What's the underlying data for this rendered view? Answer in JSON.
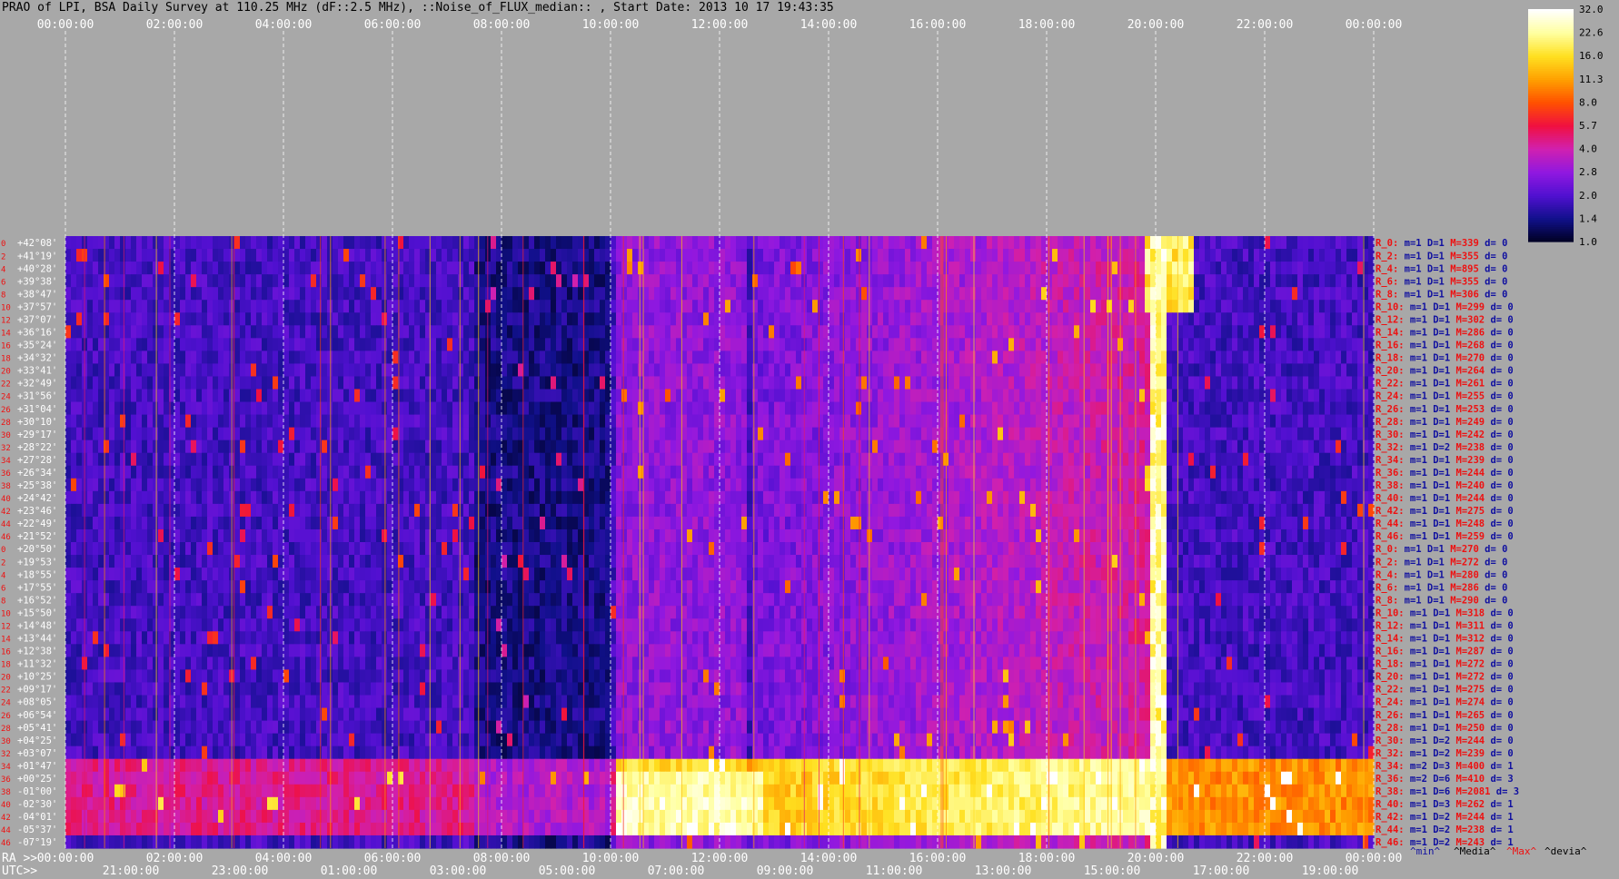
{
  "title": "PRAO of LPI, BSA Daily Survey at 110.25 MHz (dF::2.5 MHz), ::Noise_of_FLUX_median:: , Start Date: 2013 10 17 19:43:35",
  "chart_data": {
    "type": "heatmap",
    "top_axis_ticks": [
      "00:00:00",
      "02:00:00",
      "04:00:00",
      "06:00:00",
      "08:00:00",
      "10:00:00",
      "12:00:00",
      "14:00:00",
      "16:00:00",
      "18:00:00",
      "20:00:00",
      "22:00:00",
      "00:00:00"
    ],
    "ra_prefix": "RA >>",
    "ra_ticks": [
      "00:00:00",
      "02:00:00",
      "04:00:00",
      "06:00:00",
      "08:00:00",
      "10:00:00",
      "12:00:00",
      "14:00:00",
      "16:00:00",
      "18:00:00",
      "20:00:00",
      "22:00:00",
      "00:00:00"
    ],
    "utc_prefix": "UTC>>",
    "utc_ticks": [
      "21:00:00",
      "23:00:00",
      "01:00:00",
      "03:00:00",
      "05:00:00",
      "07:00:00",
      "09:00:00",
      "11:00:00",
      "13:00:00",
      "15:00:00",
      "17:00:00",
      "19:00:00"
    ],
    "declinations": [
      "+42°08'",
      "+41°19'",
      "+40°28'",
      "+39°38'",
      "+38°47'",
      "+37°57'",
      "+37°07'",
      "+36°16'",
      "+35°24'",
      "+34°32'",
      "+33°41'",
      "+32°49'",
      "+31°56'",
      "+31°04'",
      "+30°10'",
      "+29°17'",
      "+28°22'",
      "+27°28'",
      "+26°34'",
      "+25°38'",
      "+24°42'",
      "+23°46'",
      "+22°49'",
      "+21°52'",
      "+20°50'",
      "+19°53'",
      "+18°55'",
      "+17°55'",
      "+16°52'",
      "+15°50'",
      "+14°48'",
      "+13°44'",
      "+12°38'",
      "+11°32'",
      "+10°25'",
      "+09°17'",
      "+08°05'",
      "+06°54'",
      "+05°41'",
      "+04°25'",
      "+03°07'",
      "+01°47'",
      "+00°25'",
      "-01°00'",
      "-02°30'",
      "-04°01'",
      "-05°37'",
      "-07°19'"
    ],
    "row_index_labels": [
      "0",
      "2",
      "4",
      "6",
      "8",
      "10",
      "12",
      "14",
      "16",
      "18",
      "20",
      "22",
      "24",
      "26",
      "28",
      "30",
      "32",
      "34",
      "36",
      "38",
      "40",
      "42",
      "44",
      "46",
      "0",
      "2",
      "4",
      "6",
      "8",
      "10",
      "12",
      "14",
      "16",
      "18",
      "20",
      "22",
      "24",
      "26",
      "28",
      "30",
      "32",
      "34",
      "36",
      "38",
      "40",
      "42",
      "44",
      "46"
    ],
    "beam_stats": [
      {
        "r": "R_0:",
        "m": "m=1",
        "D": "D=1",
        "M": "M=339",
        "d": "d= 0"
      },
      {
        "r": "R_2:",
        "m": "m=1",
        "D": "D=1",
        "M": "M=355",
        "d": "d= 0"
      },
      {
        "r": "R_4:",
        "m": "m=1",
        "D": "D=1",
        "M": "M=895",
        "d": "d= 0"
      },
      {
        "r": "R_6:",
        "m": "m=1",
        "D": "D=1",
        "M": "M=355",
        "d": "d= 0"
      },
      {
        "r": "R_8:",
        "m": "m=1",
        "D": "D=1",
        "M": "M=306",
        "d": "d= 0"
      },
      {
        "r": "R_10:",
        "m": "m=1",
        "D": "D=1",
        "M": "M=299",
        "d": "d= 0"
      },
      {
        "r": "R_12:",
        "m": "m=1",
        "D": "D=1",
        "M": "M=302",
        "d": "d= 0"
      },
      {
        "r": "R_14:",
        "m": "m=1",
        "D": "D=1",
        "M": "M=286",
        "d": "d= 0"
      },
      {
        "r": "R_16:",
        "m": "m=1",
        "D": "D=1",
        "M": "M=268",
        "d": "d= 0"
      },
      {
        "r": "R_18:",
        "m": "m=1",
        "D": "D=1",
        "M": "M=270",
        "d": "d= 0"
      },
      {
        "r": "R_20:",
        "m": "m=1",
        "D": "D=1",
        "M": "M=264",
        "d": "d= 0"
      },
      {
        "r": "R_22:",
        "m": "m=1",
        "D": "D=1",
        "M": "M=261",
        "d": "d= 0"
      },
      {
        "r": "R_24:",
        "m": "m=1",
        "D": "D=1",
        "M": "M=255",
        "d": "d= 0"
      },
      {
        "r": "R_26:",
        "m": "m=1",
        "D": "D=1",
        "M": "M=253",
        "d": "d= 0"
      },
      {
        "r": "R_28:",
        "m": "m=1",
        "D": "D=1",
        "M": "M=249",
        "d": "d= 0"
      },
      {
        "r": "R_30:",
        "m": "m=1",
        "D": "D=1",
        "M": "M=242",
        "d": "d= 0"
      },
      {
        "r": "R_32:",
        "m": "m=1",
        "D": "D=2",
        "M": "M=238",
        "d": "d= 0"
      },
      {
        "r": "R_34:",
        "m": "m=1",
        "D": "D=1",
        "M": "M=239",
        "d": "d= 0"
      },
      {
        "r": "R_36:",
        "m": "m=1",
        "D": "D=1",
        "M": "M=244",
        "d": "d= 0"
      },
      {
        "r": "R_38:",
        "m": "m=1",
        "D": "D=1",
        "M": "M=240",
        "d": "d= 0"
      },
      {
        "r": "R_40:",
        "m": "m=1",
        "D": "D=1",
        "M": "M=244",
        "d": "d= 0"
      },
      {
        "r": "R_42:",
        "m": "m=1",
        "D": "D=1",
        "M": "M=275",
        "d": "d= 0"
      },
      {
        "r": "R_44:",
        "m": "m=1",
        "D": "D=1",
        "M": "M=248",
        "d": "d= 0"
      },
      {
        "r": "R_46:",
        "m": "m=1",
        "D": "D=1",
        "M": "M=259",
        "d": "d= 0"
      },
      {
        "r": "R_0:",
        "m": "m=1",
        "D": "D=1",
        "M": "M=270",
        "d": "d= 0"
      },
      {
        "r": "R_2:",
        "m": "m=1",
        "D": "D=1",
        "M": "M=272",
        "d": "d= 0"
      },
      {
        "r": "R_4:",
        "m": "m=1",
        "D": "D=1",
        "M": "M=280",
        "d": "d= 0"
      },
      {
        "r": "R_6:",
        "m": "m=1",
        "D": "D=1",
        "M": "M=286",
        "d": "d= 0"
      },
      {
        "r": "R_8:",
        "m": "m=1",
        "D": "D=1",
        "M": "M=290",
        "d": "d= 0"
      },
      {
        "r": "R_10:",
        "m": "m=1",
        "D": "D=1",
        "M": "M=318",
        "d": "d= 0"
      },
      {
        "r": "R_12:",
        "m": "m=1",
        "D": "D=1",
        "M": "M=311",
        "d": "d= 0"
      },
      {
        "r": "R_14:",
        "m": "m=1",
        "D": "D=1",
        "M": "M=312",
        "d": "d= 0"
      },
      {
        "r": "R_16:",
        "m": "m=1",
        "D": "D=1",
        "M": "M=287",
        "d": "d= 0"
      },
      {
        "r": "R_18:",
        "m": "m=1",
        "D": "D=1",
        "M": "M=272",
        "d": "d= 0"
      },
      {
        "r": "R_20:",
        "m": "m=1",
        "D": "D=1",
        "M": "M=272",
        "d": "d= 0"
      },
      {
        "r": "R_22:",
        "m": "m=1",
        "D": "D=1",
        "M": "M=275",
        "d": "d= 0"
      },
      {
        "r": "R_24:",
        "m": "m=1",
        "D": "D=1",
        "M": "M=274",
        "d": "d= 0"
      },
      {
        "r": "R_26:",
        "m": "m=1",
        "D": "D=1",
        "M": "M=265",
        "d": "d= 0"
      },
      {
        "r": "R_28:",
        "m": "m=1",
        "D": "D=1",
        "M": "M=250",
        "d": "d= 0"
      },
      {
        "r": "R_30:",
        "m": "m=1",
        "D": "D=2",
        "M": "M=244",
        "d": "d= 0"
      },
      {
        "r": "R_32:",
        "m": "m=1",
        "D": "D=2",
        "M": "M=239",
        "d": "d= 0"
      },
      {
        "r": "R_34:",
        "m": "m=2",
        "D": "D=3",
        "M": "M=400",
        "d": "d= 1"
      },
      {
        "r": "R_36:",
        "m": "m=2",
        "D": "D=6",
        "M": "M=410",
        "d": "d= 3"
      },
      {
        "r": "R_38:",
        "m": "m=1",
        "D": "D=6",
        "M": "M=2081",
        "d": "d= 3"
      },
      {
        "r": "R_40:",
        "m": "m=1",
        "D": "D=3",
        "M": "M=262",
        "d": "d= 1"
      },
      {
        "r": "R_42:",
        "m": "m=1",
        "D": "D=2",
        "M": "M=244",
        "d": "d= 1"
      },
      {
        "r": "R_44:",
        "m": "m=1",
        "D": "D=2",
        "M": "M=238",
        "d": "d= 1"
      },
      {
        "r": "R_46:",
        "m": "m=1",
        "D": "D=2",
        "M": "M=243",
        "d": "d= 1"
      }
    ],
    "stats_footer": {
      "min": "^min^",
      "median": "^Media^",
      "max": "^Max^",
      "devia": "^devia^"
    },
    "colorbar_ticks": [
      "32.0",
      "22.6",
      "16.0",
      "11.3",
      "8.0",
      "5.7",
      "4.0",
      "2.8",
      "2.0",
      "1.4",
      "1.0"
    ],
    "colorbar_range": [
      1.0,
      32.0
    ],
    "colormap": [
      "#000020",
      "#10108a",
      "#5010d0",
      "#9018e0",
      "#d020b0",
      "#f01040",
      "#ff5000",
      "#ffa000",
      "#ffe020",
      "#ffffa0",
      "#ffffff"
    ],
    "colors": {
      "background": "#a8a8a8",
      "axis_text": "#ffffff",
      "stat_red": "#ee1111",
      "stat_blue": "#1010a0",
      "dec_text": "#ffffff",
      "index_red": "#ee1111"
    },
    "features": [
      {
        "note": "bright band",
        "dec_rows": [
          41,
          47
        ],
        "ra_hours": [
          0,
          24
        ]
      },
      {
        "note": "strong source",
        "dec_rows": [
          42,
          46
        ],
        "ra_hours": [
          10,
          12.8
        ]
      },
      {
        "note": "strong source",
        "dec_rows": [
          0,
          47
        ],
        "ra_hours": [
          19.8,
          20.2
        ]
      },
      {
        "note": "strong source",
        "dec_rows": [
          0,
          5
        ],
        "ra_hours": [
          19.7,
          20.6
        ]
      }
    ]
  }
}
